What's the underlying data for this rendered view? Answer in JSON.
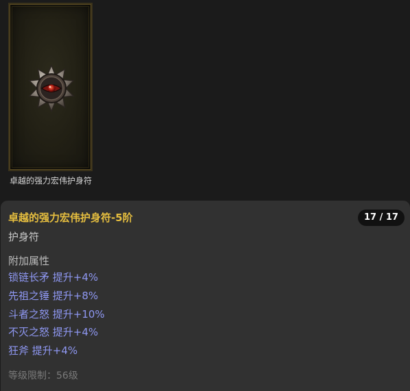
{
  "item": {
    "name": "卓越的强力宏伟护身符",
    "icon": "amulet-icon"
  },
  "tooltip": {
    "title": "卓越的强力宏伟护身符-5阶",
    "counter": "17 / 17",
    "type": "护身符",
    "section_label": "附加属性",
    "affixes": [
      "锁链长矛 提升+4%",
      "先祖之锤 提升+8%",
      "斗者之怒 提升+10%",
      "不灭之怒 提升+4%",
      "狂斧 提升+4%"
    ],
    "level_req": "等级限制：56级"
  },
  "colors": {
    "title": "#e7bf3f",
    "affix": "#8f98f3",
    "panel": "#313131",
    "background": "#1b1b1b"
  }
}
